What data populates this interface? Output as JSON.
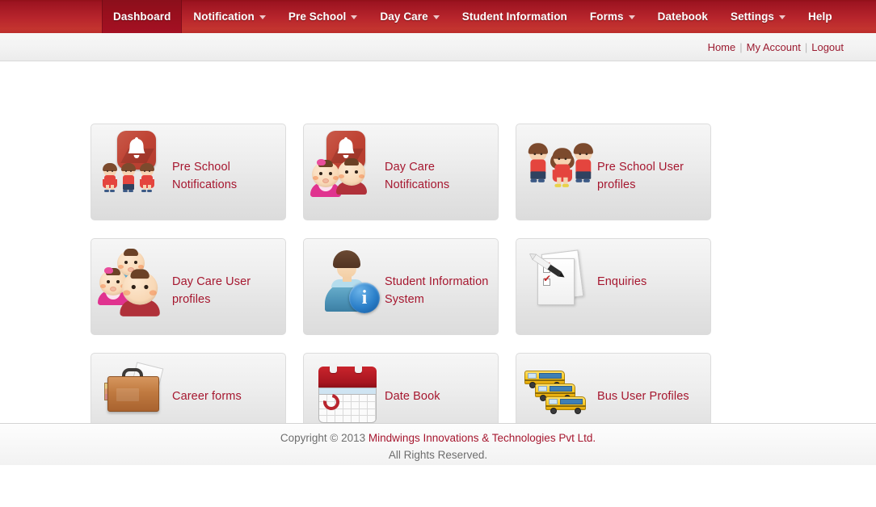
{
  "nav": {
    "items": [
      {
        "label": "Dashboard",
        "has_caret": false,
        "active": true
      },
      {
        "label": "Notification",
        "has_caret": true,
        "active": false
      },
      {
        "label": "Pre School",
        "has_caret": true,
        "active": false
      },
      {
        "label": "Day Care",
        "has_caret": true,
        "active": false
      },
      {
        "label": "Student Information",
        "has_caret": false,
        "active": false
      },
      {
        "label": "Forms",
        "has_caret": true,
        "active": false
      },
      {
        "label": "Datebook",
        "has_caret": false,
        "active": false
      },
      {
        "label": "Settings",
        "has_caret": true,
        "active": false
      },
      {
        "label": "Help",
        "has_caret": false,
        "active": false
      }
    ],
    "bg_start": "#8f1019",
    "bg_end": "#bb2d2b",
    "active_bg": "#990f1d",
    "text_color": "#ffffff"
  },
  "subheader": {
    "links": [
      {
        "label": "Home"
      },
      {
        "label": "My Account"
      },
      {
        "label": "Logout"
      }
    ],
    "separator": "|",
    "link_color": "#9b1b30"
  },
  "tiles": [
    {
      "label": "Pre School Notifications",
      "icon": "bell-with-children-icon"
    },
    {
      "label": "Day Care Notifications",
      "icon": "bell-with-babies-icon"
    },
    {
      "label": "Pre School User profiles",
      "icon": "three-children-icon"
    },
    {
      "label": "Day Care User profiles",
      "icon": "three-babies-icon"
    },
    {
      "label": "Student Information System",
      "icon": "person-info-icon"
    },
    {
      "label": "Enquiries",
      "icon": "checklist-pen-icon"
    },
    {
      "label": "Career forms",
      "icon": "briefcase-icon"
    },
    {
      "label": "Date Book",
      "icon": "calendar-icon"
    },
    {
      "label": "Bus User Profiles",
      "icon": "school-buses-icon"
    }
  ],
  "tile_label_color": "#a6172f",
  "footer": {
    "copyright_prefix": "Copyright © 2013 ",
    "company": "Mindwings Innovations & Technologies Pvt Ltd.",
    "rights": "All Rights Reserved.",
    "text_color": "#6e6e6e",
    "brand_color": "#a6172f"
  }
}
